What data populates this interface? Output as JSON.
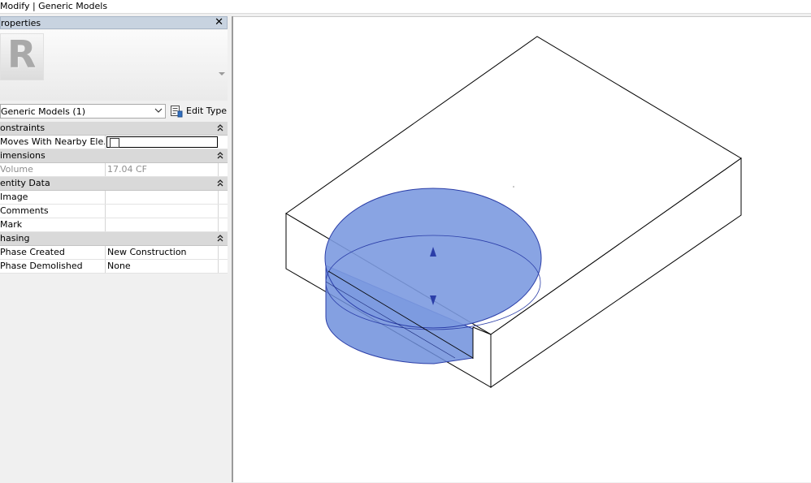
{
  "titlebar": {
    "text": "Modify | Generic Models"
  },
  "properties": {
    "title": "roperties",
    "close_glyph": "✕",
    "thumbnail_letter": "R",
    "type_selector": "Generic Models (1)",
    "edit_type_label": "Edit Type",
    "sections": [
      {
        "label": "onstraints",
        "rows": [
          {
            "key": "Moves With Nearby Ele...",
            "value": "",
            "kind": "checkbox"
          }
        ]
      },
      {
        "label": "imensions",
        "rows": [
          {
            "key": "Volume",
            "value": "17.04 CF",
            "kind": "readonly"
          }
        ]
      },
      {
        "label": "entity Data",
        "rows": [
          {
            "key": "Image",
            "value": ""
          },
          {
            "key": "Comments",
            "value": ""
          },
          {
            "key": "Mark",
            "value": ""
          }
        ]
      },
      {
        "label": "hasing",
        "rows": [
          {
            "key": "Phase Created",
            "value": "New Construction"
          },
          {
            "key": "Phase Demolished",
            "value": "None"
          }
        ]
      }
    ]
  },
  "viewport": {
    "selection_color": "#6f8fdc",
    "icons": [
      "flip-up-arrow-icon",
      "flip-down-arrow-icon"
    ]
  }
}
